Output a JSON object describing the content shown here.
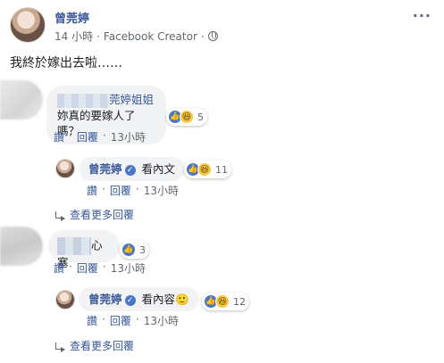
{
  "post": {
    "author": "曾莞婷",
    "time": "14 小時",
    "source": "Facebook Creator",
    "more_label": "···",
    "text": "我終於嫁出去啦……"
  },
  "comments": [
    {
      "author_visible": "莞婷姐姐",
      "text": "妳真的要嫁人了嗎？",
      "reaction_count": "5",
      "reactions": [
        "like-icon",
        "haha-icon"
      ],
      "actions": {
        "like": "讚",
        "reply": "回覆",
        "time": "13小時"
      },
      "reply": {
        "author": "曾莞婷",
        "text": "看內文",
        "reaction_count": "11",
        "reactions": [
          "like-icon",
          "haha-icon"
        ],
        "actions": {
          "like": "讚",
          "reply": "回覆",
          "time": "13小時"
        }
      },
      "more_replies": "查看更多回覆"
    },
    {
      "author_visible": "",
      "text": "心塞",
      "reaction_count": "3",
      "reactions": [
        "like-icon"
      ],
      "actions": {
        "like": "讚",
        "reply": "回覆",
        "time": "13小時"
      },
      "reply": {
        "author": "曾莞婷",
        "text": "看內容",
        "emoji": "🙂",
        "reaction_count": "12",
        "reactions": [
          "like-icon",
          "haha-icon"
        ],
        "actions": {
          "like": "讚",
          "reply": "回覆",
          "time": "13小時"
        }
      },
      "more_replies": "查看更多回覆"
    }
  ],
  "colors": {
    "link": "#385898",
    "meta": "#616770",
    "bubble": "#f2f3f5",
    "like": "#4a76c6",
    "haha": "#f7c94a"
  }
}
